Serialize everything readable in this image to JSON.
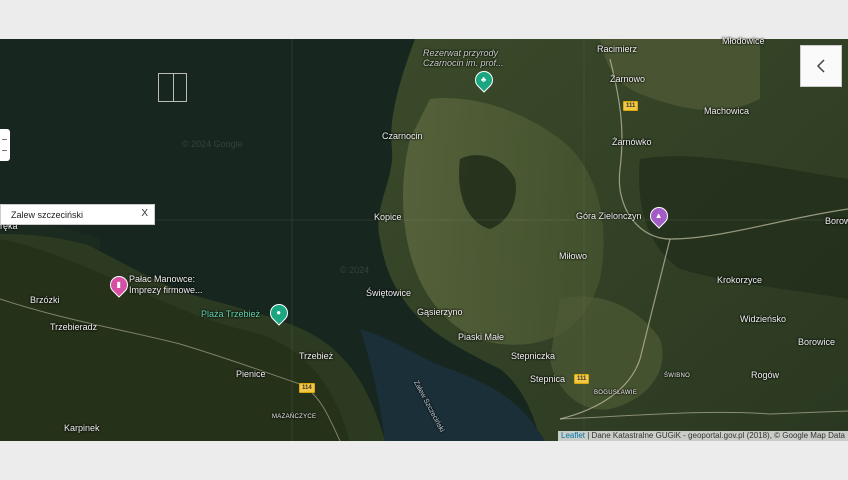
{
  "map": {
    "places": [
      {
        "id": "rezerwat",
        "text": "Rezerwat przyrody\nCzarnocin im. prof..."
      },
      {
        "id": "racimierz",
        "text": "Racimierz"
      },
      {
        "id": "mlodowice",
        "text": "Młodowice"
      },
      {
        "id": "zarnowo",
        "text": "Żarnowo"
      },
      {
        "id": "machowica",
        "text": "Machowica"
      },
      {
        "id": "czarnocin",
        "text": "Czarnocin"
      },
      {
        "id": "zarnowko",
        "text": "Żarnówko"
      },
      {
        "id": "kopice",
        "text": "Kopice"
      },
      {
        "id": "gora",
        "text": "Góra Zielonczyn"
      },
      {
        "id": "borow",
        "text": "Borow"
      },
      {
        "id": "milowo",
        "text": "Miłowo"
      },
      {
        "id": "krokorzyce",
        "text": "Krokorzyce"
      },
      {
        "id": "brzozki",
        "text": "Brzózki"
      },
      {
        "id": "palac",
        "text": "Pałac Manowce:\nImprezy firmowe..."
      },
      {
        "id": "swietowice",
        "text": "Świętowice"
      },
      {
        "id": "widzienko",
        "text": "Widzieńsko"
      },
      {
        "id": "trzebieradz",
        "text": "Trzebieradz"
      },
      {
        "id": "plaza",
        "text": "Plaża Trzebież"
      },
      {
        "id": "gasierzyno",
        "text": "Gąsierzyno"
      },
      {
        "id": "borowice",
        "text": "Borowice"
      },
      {
        "id": "trzebiez",
        "text": "Trzebież"
      },
      {
        "id": "piaski",
        "text": "Piaski Małe"
      },
      {
        "id": "stepniczka",
        "text": "Stepniczka"
      },
      {
        "id": "pienice",
        "text": "Pienice"
      },
      {
        "id": "stepnica",
        "text": "Stepnica"
      },
      {
        "id": "rogow",
        "text": "Rogów"
      },
      {
        "id": "karpinek",
        "text": "Karpinek"
      },
      {
        "id": "reka",
        "text": "ręka"
      }
    ],
    "small_places": [
      {
        "id": "mazanczyce",
        "text": "MAZAŃCZYCE"
      },
      {
        "id": "boguslawie",
        "text": "BOGUSŁAWIE"
      },
      {
        "id": "swibno",
        "text": "ŚWIBNO"
      }
    ],
    "water_label": "Zalew Szczeciński",
    "road_signs": [
      "111",
      "114",
      "111"
    ],
    "watermarks": [
      "© 2024 Google",
      "© 2024"
    ],
    "pins": {
      "rezerwat": "tree-icon",
      "palac": "hotel-icon",
      "plaza": "beach-icon",
      "gora": "mountain-icon"
    },
    "colors": {
      "water": "#17271f",
      "land": "#2f3d23",
      "field": "#55603a",
      "pin_green": "#1aa680",
      "pin_pink": "#d64fa4",
      "pin_purple": "#a35bc7",
      "road_sign": "#f2c744"
    }
  },
  "search": {
    "value": "Zalew szczeciński",
    "clear_label": "X"
  },
  "attribution": {
    "leaflet": "Leaflet",
    "rest": " | Dane Katastralne GUGiK - geoportal.gov.pl (2018), © Google Map Data"
  }
}
